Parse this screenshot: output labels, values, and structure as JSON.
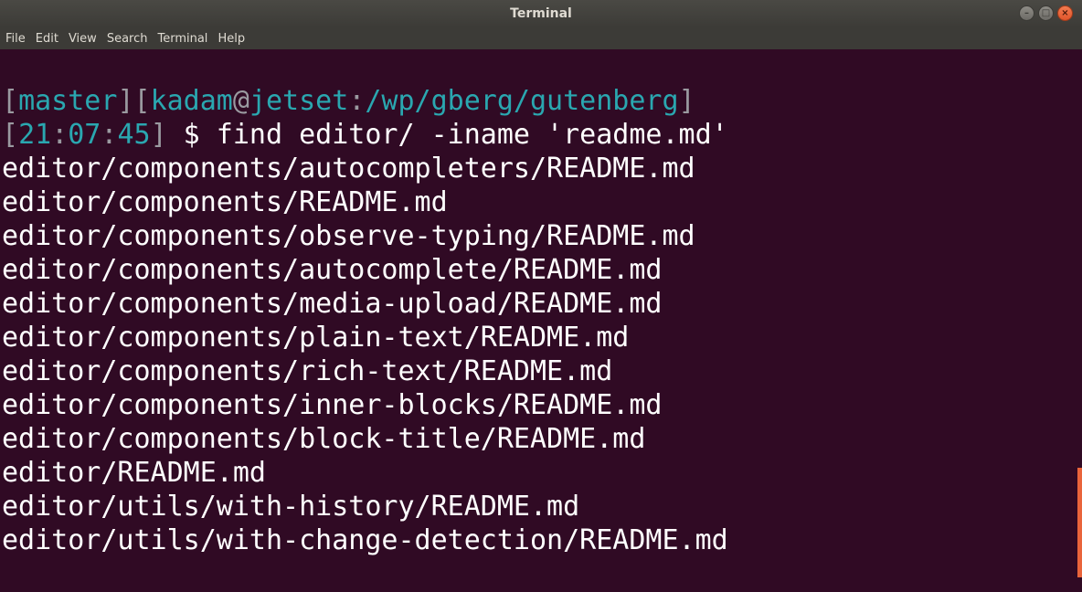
{
  "window": {
    "title": "Terminal",
    "controls": {
      "minimize": "–",
      "maximize": "□",
      "close": "×"
    }
  },
  "menu": {
    "items": [
      "File",
      "Edit",
      "View",
      "Search",
      "Terminal",
      "Help"
    ]
  },
  "prompt": {
    "lb1": "[",
    "branch": "master",
    "rb1": "]",
    "lb2": "[",
    "user": "kadam",
    "at": "@",
    "host": "jetset",
    "colon": ":",
    "path": "/wp/gberg/gutenberg",
    "rb2": "]",
    "lb3": "[",
    "hh": "21",
    "c1": ":",
    "mm": "07",
    "c2": ":",
    "ss": "45",
    "rb3": "]",
    "command": " $ find editor/ -iname 'readme.md'"
  },
  "output": [
    "editor/components/autocompleters/README.md",
    "editor/components/README.md",
    "editor/components/observe-typing/README.md",
    "editor/components/autocomplete/README.md",
    "editor/components/media-upload/README.md",
    "editor/components/plain-text/README.md",
    "editor/components/rich-text/README.md",
    "editor/components/inner-blocks/README.md",
    "editor/components/block-title/README.md",
    "editor/README.md",
    "editor/utils/with-history/README.md",
    "editor/utils/with-change-detection/README.md"
  ],
  "colors": {
    "background": "#300a24",
    "prompt_bracket": "#9a9aa0",
    "prompt_accent": "#2aa7b0",
    "text": "#ffffff",
    "scrollbar": "#e9643b"
  }
}
